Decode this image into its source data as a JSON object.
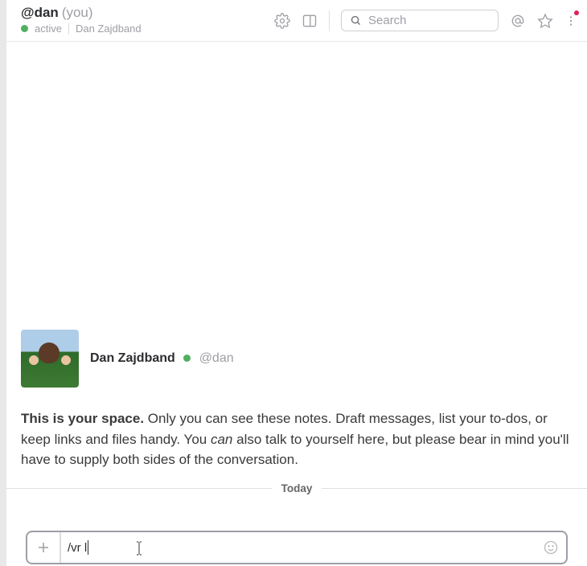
{
  "header": {
    "handle": "@dan",
    "you_suffix": "(you)",
    "status": "active",
    "full_name": "Dan Zajdband",
    "search_placeholder": "Search"
  },
  "profile": {
    "name": "Dan Zajdband",
    "handle": "@dan"
  },
  "space_text": {
    "bold": "This is your space.",
    "part1": " Only you can see these notes. Draft messages, list your to-dos, or keep links and files handy. You ",
    "italic": "can",
    "part2": " also talk to yourself here, but please bear in mind you'll have to supply both sides of the conversation."
  },
  "date_divider": "Today",
  "composer": {
    "value": "/vr l"
  }
}
